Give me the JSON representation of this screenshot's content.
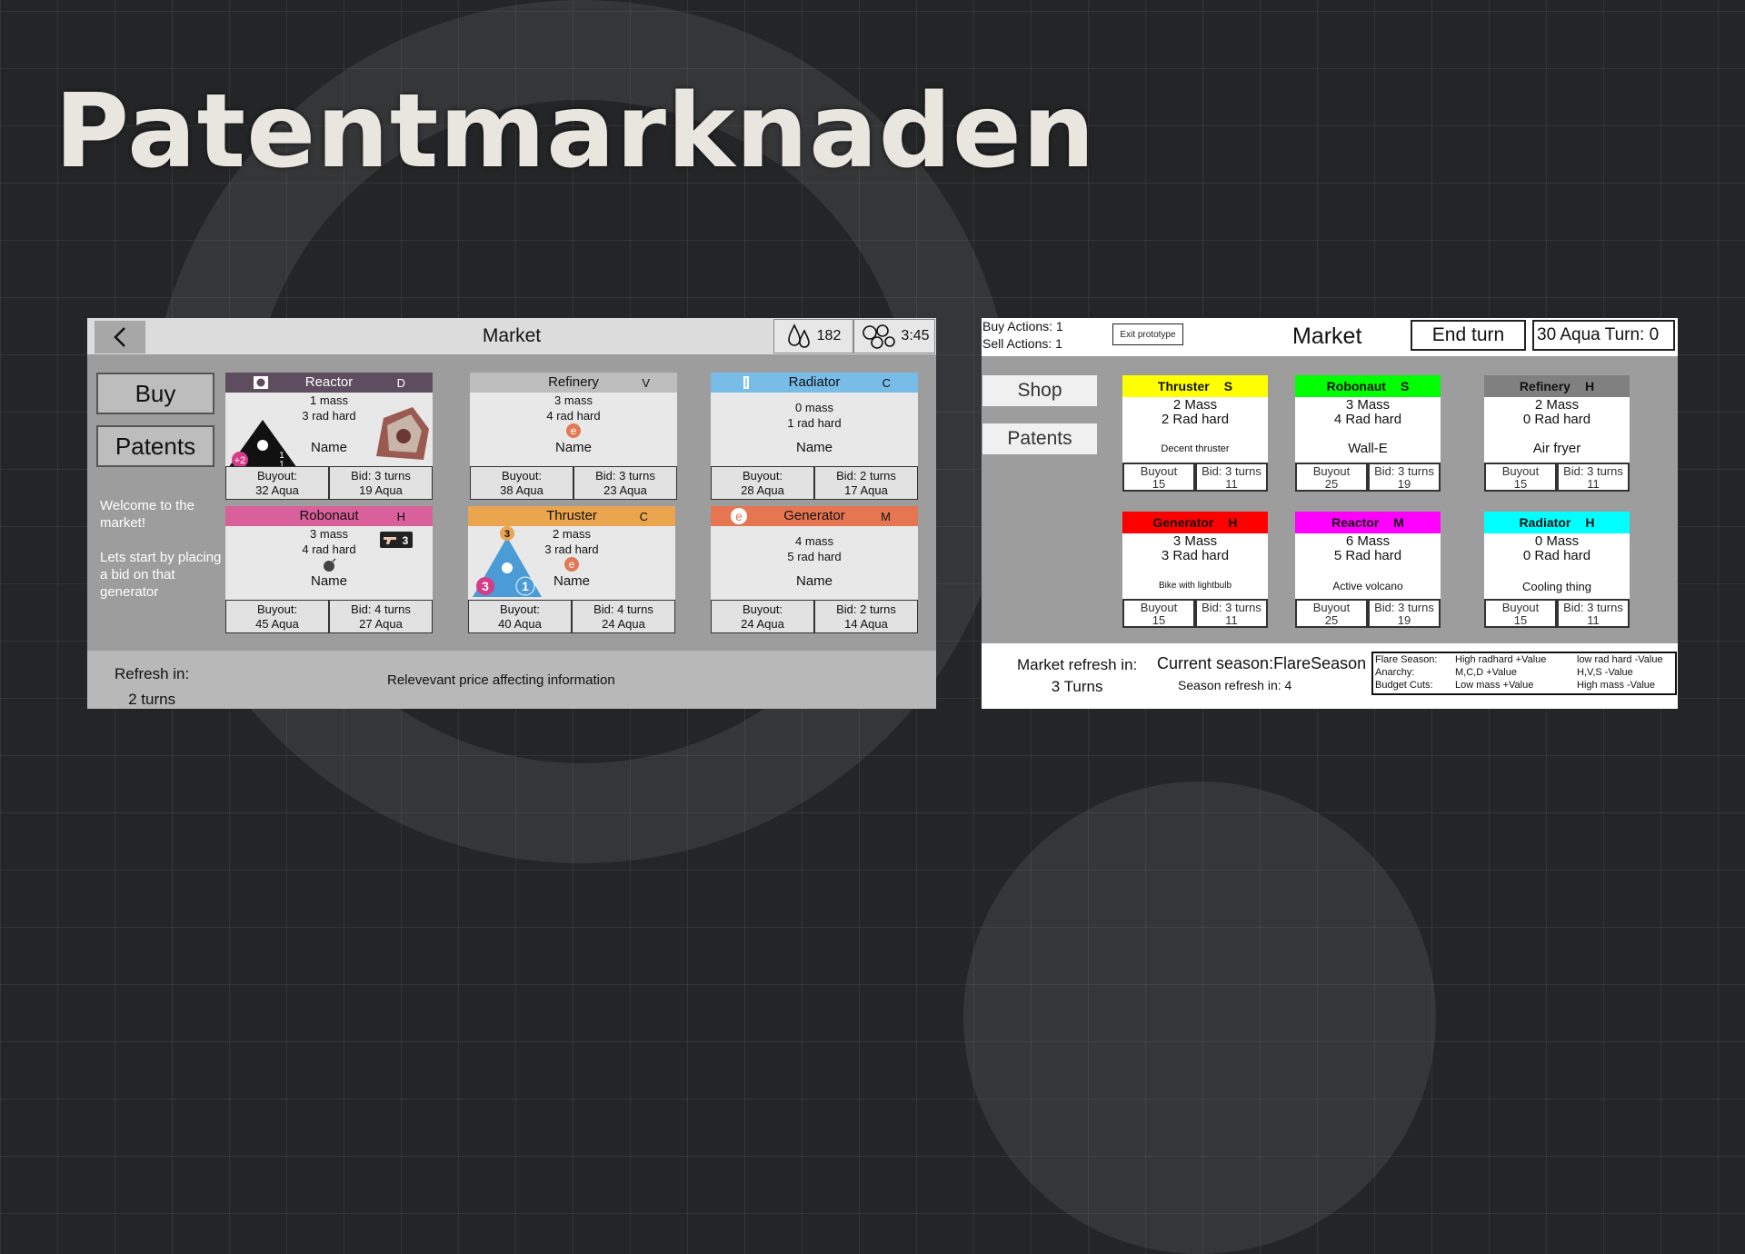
{
  "slide": {
    "title": "Patentmarknaden"
  },
  "left": {
    "title": "Market",
    "resource_value": "182",
    "timer": "3:45",
    "buttons": {
      "buy": "Buy",
      "patents": "Patents"
    },
    "welcome": "Welcome to the market!\n\nLets start by placing a bid on that generator",
    "refresh_label": "Refresh in:",
    "refresh_value": "2 turns",
    "info": "Relevevant price affecting information",
    "cards": [
      {
        "name": "Reactor",
        "tag": "D",
        "stat1": "1 mass",
        "stat2": "3 rad hard",
        "title": "Name",
        "buyout": "Buyout:",
        "buyout_value": "32 Aqua",
        "bid": "Bid: 3 turns",
        "bid_value": "19 Aqua",
        "color": "#5e4d5e"
      },
      {
        "name": "Refinery",
        "tag": "V",
        "stat1": "3 mass",
        "stat2": "4 rad hard",
        "title": "Name",
        "buyout": "Buyout:",
        "buyout_value": "38 Aqua",
        "bid": "Bid: 3 turns",
        "bid_value": "23 Aqua",
        "color": "#bdbdbd"
      },
      {
        "name": "Radiator",
        "tag": "C",
        "stat1": "0 mass",
        "stat2": "1 rad hard",
        "title": "Name",
        "buyout": "Buyout:",
        "buyout_value": "28 Aqua",
        "bid": "Bid: 2 turns",
        "bid_value": "17 Aqua",
        "color": "#78bde8"
      },
      {
        "name": "Robonaut",
        "tag": "H",
        "stat1": "3 mass",
        "stat2": "4 rad hard",
        "title": "Name",
        "buyout": "Buyout:",
        "buyout_value": "45 Aqua",
        "bid": "Bid: 4 turns",
        "bid_value": "27 Aqua",
        "color": "#d9609a"
      },
      {
        "name": "Thruster",
        "tag": "C",
        "stat1": "2 mass",
        "stat2": "3 rad hard",
        "title": "Name",
        "buyout": "Buyout:",
        "buyout_value": "40 Aqua",
        "bid": "Bid: 4 turns",
        "bid_value": "24 Aqua",
        "color": "#eaa54e"
      },
      {
        "name": "Generator",
        "tag": "M",
        "stat1": "4 mass",
        "stat2": "5 rad hard",
        "title": "Name",
        "buyout": "Buyout:",
        "buyout_value": "24 Aqua",
        "bid": "Bid: 2 turns",
        "bid_value": "14 Aqua",
        "color": "#e67552"
      }
    ],
    "reactor_badges": {
      "plus": "+2",
      "num": "1",
      "den": "1"
    },
    "robonaut_badge": "3",
    "thruster_badges": {
      "top": "3",
      "left": "3",
      "right": "1"
    },
    "e_glyph": "e"
  },
  "right": {
    "actions": "Buy Actions: 1\nSell Actions: 1",
    "exit": "Exit prototype",
    "title": "Market",
    "end_turn": "End turn",
    "status": "30 Aqua   Turn: 0",
    "shop": "Shop",
    "patents": "Patents",
    "refresh_label": "Market refresh in:",
    "refresh_value": "3 Turns",
    "season": "Current season:FlareSeason",
    "season_refresh": "Season refresh in: 4",
    "info_rows": [
      {
        "label": "Flare Season:",
        "a": "High radhard +Value",
        "b": "low rad hard -Value"
      },
      {
        "label": "Anarchy:",
        "a": "M,C,D +Value",
        "b": "H,V,S -Value"
      },
      {
        "label": "Budget Cuts:",
        "a": "Low mass +Value",
        "b": "High mass -Value"
      }
    ],
    "cards": [
      {
        "name": "Thruster",
        "tag": "S",
        "stat1": "2 Mass",
        "stat2": "2 Rad hard",
        "title": "Decent thruster",
        "buy": "Buyout",
        "buy_v": "15",
        "bid": "Bid: 3 turns",
        "bid_v": "11",
        "color": "#ffff00"
      },
      {
        "name": "Robonaut",
        "tag": "S",
        "stat1": "3 Mass",
        "stat2": "4 Rad hard",
        "title": "Wall-E",
        "buy": "Buyout",
        "buy_v": "25",
        "bid": "Bid: 3 turns",
        "bid_v": "19",
        "color": "#00ff00"
      },
      {
        "name": "Refinery",
        "tag": "H",
        "stat1": "2 Mass",
        "stat2": "0 Rad hard",
        "title": "Air fryer",
        "buy": "Buyout",
        "buy_v": "15",
        "bid": "Bid: 3 turns",
        "bid_v": "11",
        "color": "#808080"
      },
      {
        "name": "Generator",
        "tag": "H",
        "stat1": "3 Mass",
        "stat2": "3 Rad hard",
        "title": "Bike with lightbulb",
        "buy": "Buyout",
        "buy_v": "15",
        "bid": "Bid: 3 turns",
        "bid_v": "11",
        "color": "#ff0000"
      },
      {
        "name": "Reactor",
        "tag": "M",
        "stat1": "6 Mass",
        "stat2": "5 Rad hard",
        "title": "Active volcano",
        "buy": "Buyout",
        "buy_v": "25",
        "bid": "Bid: 3 turns",
        "bid_v": "19",
        "color": "#ff00ff"
      },
      {
        "name": "Radiator",
        "tag": "H",
        "stat1": "0 Mass",
        "stat2": "0 Rad hard",
        "title": "Cooling thing",
        "buy": "Buyout",
        "buy_v": "15",
        "bid": "Bid: 3 turns",
        "bid_v": "11",
        "color": "#00ffff"
      }
    ]
  }
}
